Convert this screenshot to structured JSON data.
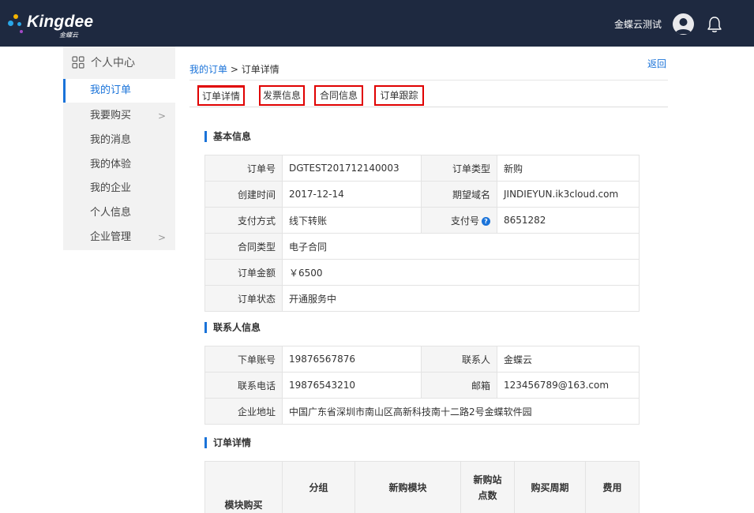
{
  "header": {
    "logo_text": "Kingdee",
    "logo_sub": "金蝶云",
    "user_name": "金蝶云测试"
  },
  "sidebar": {
    "title": "个人中心",
    "items": [
      {
        "label": "我的订单",
        "active": true
      },
      {
        "label": "我要购买",
        "chevron": ">"
      },
      {
        "label": "我的消息"
      },
      {
        "label": "我的体验"
      },
      {
        "label": "我的企业"
      },
      {
        "label": "个人信息"
      },
      {
        "label": "企业管理",
        "chevron": ">"
      }
    ]
  },
  "breadcrumb": {
    "parent": "我的订单",
    "separator": " > ",
    "current": "订单详情"
  },
  "back_label": "返回",
  "tabs": [
    "订单详情",
    "发票信息",
    "合同信息",
    "订单跟踪"
  ],
  "sections": {
    "basic": "基本信息",
    "contact": "联系人信息",
    "detail": "订单详情"
  },
  "basic_info": {
    "order_no_label": "订单号",
    "order_no": "DGTEST201712140003",
    "order_type_label": "订单类型",
    "order_type": "新购",
    "created_label": "创建时间",
    "created": "2017-12-14",
    "domain_label": "期望域名",
    "domain": "JINDIEYUN.ik3cloud.com",
    "pay_method_label": "支付方式",
    "pay_method": "线下转账",
    "pay_no_label": "支付号",
    "pay_no": "8651282",
    "contract_type_label": "合同类型",
    "contract_type": "电子合同",
    "amount_label": "订单金额",
    "amount": "￥6500",
    "status_label": "订单状态",
    "status": "开通服务中"
  },
  "contact_info": {
    "account_label": "下单账号",
    "account": "19876567876",
    "contact_label": "联系人",
    "contact": "金蝶云",
    "phone_label": "联系电话",
    "phone": "19876543210",
    "email_label": "邮箱",
    "email": "123456789@163.com",
    "address_label": "企业地址",
    "address": "中国广东省深圳市南山区高新科技南十二路2号金蝶软件园"
  },
  "detail_table": {
    "row_header": "模块购买",
    "columns": [
      "分组",
      "新购模块",
      "新购站点数",
      "购买周期",
      "费用"
    ]
  },
  "colors": {
    "header_bg": "#1e2940",
    "accent": "#1a73d9",
    "highlight_border": "#e00000",
    "price": "#e02020"
  }
}
